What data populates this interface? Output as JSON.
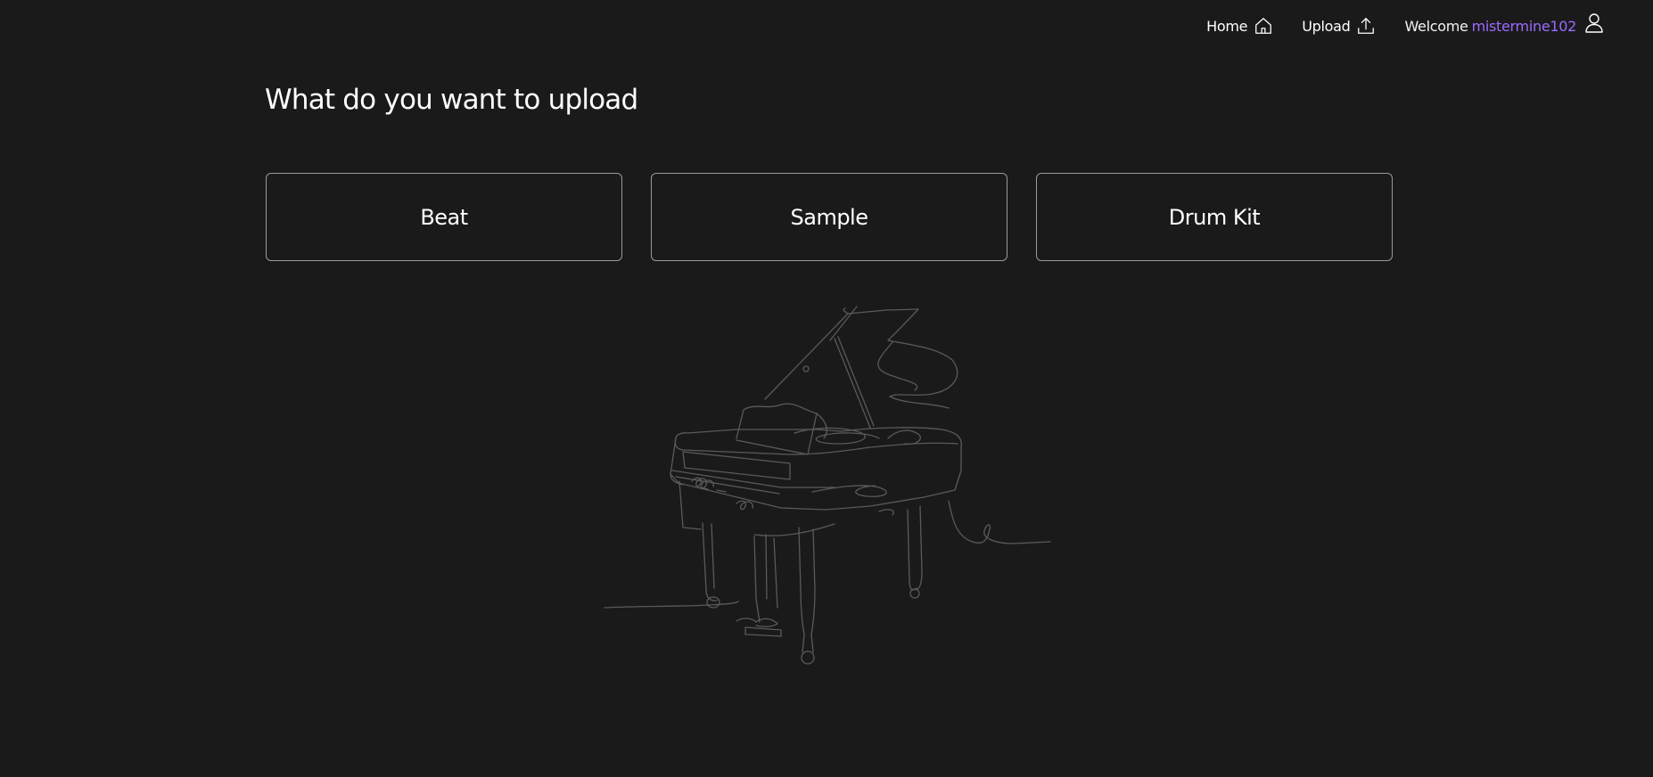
{
  "nav": {
    "home_label": "Home",
    "home_icon": "home-icon",
    "upload_label": "Upload",
    "upload_icon": "upload-icon",
    "welcome_label": "Welcome",
    "username": "mistermine102",
    "user_icon": "user-icon"
  },
  "main": {
    "title": "What do you want to upload",
    "options": [
      {
        "label": "Beat"
      },
      {
        "label": "Sample"
      },
      {
        "label": "Drum Kit"
      }
    ]
  },
  "illustration": {
    "name": "grand-piano-line-drawing"
  },
  "colors": {
    "background": "#1a1a1a",
    "text": "#ffffff",
    "accent": "#9b6bff",
    "card_border": "#9a9a9a",
    "illustration_stroke": "#5a5a5a"
  }
}
